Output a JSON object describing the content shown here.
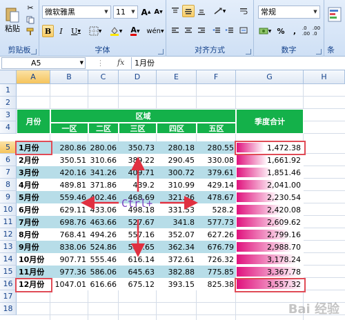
{
  "ribbon": {
    "clipboard": {
      "paste": "粘贴",
      "label": "剪贴板"
    },
    "font": {
      "name": "微软雅黑",
      "size": "11",
      "bold": "B",
      "italic": "I",
      "underline": "U",
      "grow": "A",
      "shrink": "A",
      "phonetic": "wén",
      "label": "字体"
    },
    "alignment": {
      "label": "对齐方式"
    },
    "number": {
      "format": "常规",
      "percent": "%",
      "comma": ",",
      "label": "数字"
    },
    "styles": {
      "label": "条"
    }
  },
  "formula_bar": {
    "name_box": "A5",
    "fx": "fx",
    "content": "1月份"
  },
  "columns": [
    "A",
    "B",
    "C",
    "D",
    "E",
    "F",
    "G",
    "H"
  ],
  "rows": [
    "1",
    "2",
    "3",
    "4",
    "5",
    "6",
    "7",
    "8",
    "9",
    "10",
    "11",
    "12",
    "13",
    "14",
    "15",
    "16",
    "17",
    "18"
  ],
  "table": {
    "month_header": "月份",
    "region_header": "区域",
    "regions": [
      "一区",
      "二区",
      "三区",
      "四区",
      "五区"
    ],
    "total_header": "季度合计",
    "data": [
      {
        "month": "1月份",
        "values": [
          "280.86",
          "280.06",
          "350.73",
          "280.18",
          "280.55"
        ],
        "total": "1,472.38"
      },
      {
        "month": "2月份",
        "values": [
          "350.51",
          "310.66",
          "389.22",
          "290.45",
          "330.08"
        ],
        "total": "1,661.92"
      },
      {
        "month": "3月份",
        "values": [
          "420.16",
          "341.26",
          "409.71",
          "300.72",
          "379.61"
        ],
        "total": "1,851.46"
      },
      {
        "month": "4月份",
        "values": [
          "489.81",
          "371.86",
          "439.2",
          "310.99",
          "429.14"
        ],
        "total": "2,041.00"
      },
      {
        "month": "5月份",
        "values": [
          "559.46",
          "402.46",
          "468.69",
          "321.26",
          "478.67"
        ],
        "total": "2,230.54"
      },
      {
        "month": "6月份",
        "values": [
          "629.11",
          "433.06",
          "498.18",
          "331.53",
          "528.2"
        ],
        "total": "2,420.08"
      },
      {
        "month": "7月份",
        "values": [
          "698.76",
          "463.66",
          "527.67",
          "341.8",
          "577.73"
        ],
        "total": "2,609.62"
      },
      {
        "month": "8月份",
        "values": [
          "768.41",
          "494.26",
          "557.16",
          "352.07",
          "627.26"
        ],
        "total": "2,799.16"
      },
      {
        "month": "9月份",
        "values": [
          "838.06",
          "524.86",
          "586.65",
          "362.34",
          "676.79"
        ],
        "total": "2,988.70"
      },
      {
        "month": "10月份",
        "values": [
          "907.71",
          "555.46",
          "616.14",
          "372.61",
          "726.32"
        ],
        "total": "3,178.24"
      },
      {
        "month": "11月份",
        "values": [
          "977.36",
          "586.06",
          "645.63",
          "382.88",
          "775.85"
        ],
        "total": "3,367.78"
      },
      {
        "month": "12月份",
        "values": [
          "1047.01",
          "616.66",
          "675.12",
          "393.15",
          "825.38"
        ],
        "total": "3,557.32"
      }
    ],
    "total_fraction": [
      0.414,
      0.467,
      0.52,
      0.574,
      0.627,
      0.68,
      0.734,
      0.787,
      0.84,
      0.893,
      0.947,
      1.0
    ]
  },
  "annotation": {
    "ctrl_label": "Ctrl+",
    "watermark": "Bai 经验"
  },
  "colors": {
    "header_green": "#14b14a",
    "band_blue": "#b7dde8",
    "bar_magenta": "#e0127d",
    "highlight_red": "#e04a55",
    "arrow_red": "#e03040"
  }
}
